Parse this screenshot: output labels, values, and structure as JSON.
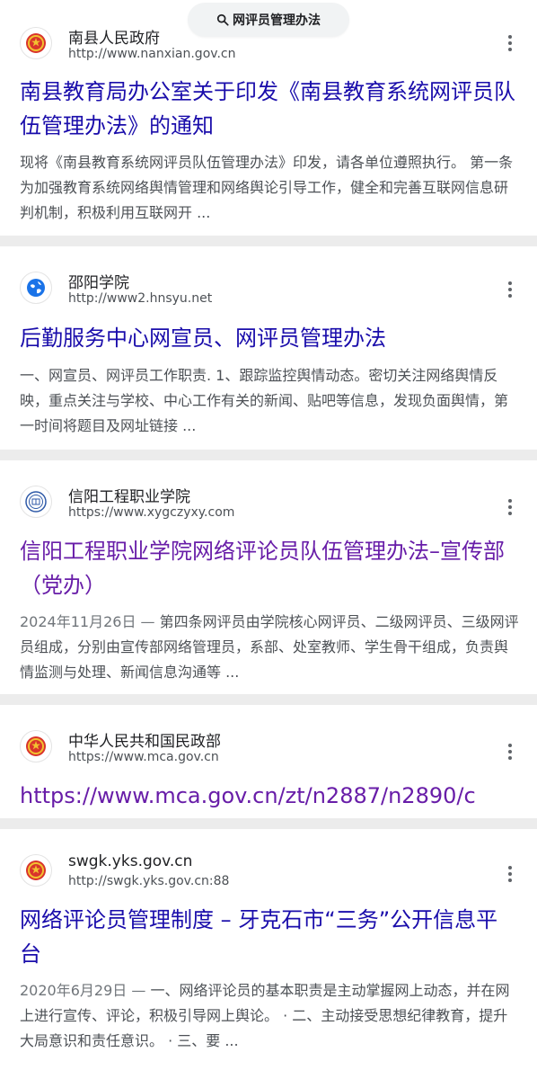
{
  "search": {
    "query": "网评员管理办法"
  },
  "results": [
    {
      "site_name": "南县人民政府",
      "url": "http://www.nanxian.gov.cn",
      "title": "南县教育局办公室关于印发《南县教育系统网评员队伍管理办法》的通知",
      "snippet": "现将《南县教育系统网评员队伍管理办法》印发，请各单位遵照执行。 第一条 为加强教育系统网络舆情管理和网络舆论引导工作，健全和完善互联网信息研判机制，积极利用互联网开 ...",
      "favicon": "emblem-icon"
    },
    {
      "site_name": "邵阳学院",
      "url": "http://www2.hnsyu.net",
      "title": "后勤服务中心网宣员、网评员管理办法",
      "snippet": "一、网宣员、网评员工作职责. 1、跟踪监控舆情动态。密切关注网络舆情反映，重点关注与学校、中心工作有关的新闻、贴吧等信息，发现负面舆情，第一时间将题目及网址链接 ...",
      "favicon": "globe-icon"
    },
    {
      "site_name": "信阳工程职业学院",
      "url": "https://www.xygczyxy.com",
      "title": "信阳工程职业学院网络评论员队伍管理办法–宣传部（党办）",
      "date": "2024年11月26日 —",
      "snippet": " 第四条网评员由学院核心网评员、二级网评员、三级网评员组成，分别由宣传部网络管理员，系部、处室教师、学生骨干组成，负责舆情监测与处理、新闻信息沟通等 ...",
      "favicon": "college-seal-icon"
    },
    {
      "site_name": "中华人民共和国民政部",
      "url": "https://www.mca.gov.cn",
      "title": "https://www.mca.gov.cn/zt/n2887/n2890/c",
      "favicon": "emblem-icon"
    },
    {
      "site_name": "swgk.yks.gov.cn",
      "url": "http://swgk.yks.gov.cn:88",
      "title": "网络评论员管理制度 – 牙克石市“三务”公开信息平台",
      "date": "2020年6月29日 —",
      "snippet": " 一、网络评论员的基本职责是主动掌握网上动态，并在网上进行宣传、评论，积极引导网上舆论。 · 二、主动接受思想纪律教育，提升大局意识和责任意识。 · 三、要 ...",
      "favicon": "emblem-icon"
    }
  ],
  "colors": {
    "link": "#1a0dab",
    "visited": "#681da8",
    "snippet": "#4d5156",
    "background": "#ececec"
  }
}
